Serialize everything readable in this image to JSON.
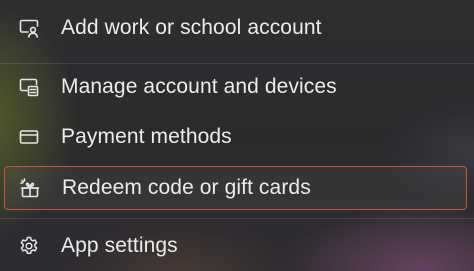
{
  "menu": {
    "items": [
      {
        "label": "Add work or school account",
        "icon": "add-account-icon"
      },
      {
        "label": "Manage account and devices",
        "icon": "devices-icon"
      },
      {
        "label": "Payment methods",
        "icon": "payment-card-icon"
      },
      {
        "label": "Redeem code or gift cards",
        "icon": "gift-icon",
        "selected": true
      },
      {
        "label": "App settings",
        "icon": "gear-icon"
      }
    ],
    "colors": {
      "text": "#ececec",
      "selection_border": "#c2563b"
    }
  }
}
